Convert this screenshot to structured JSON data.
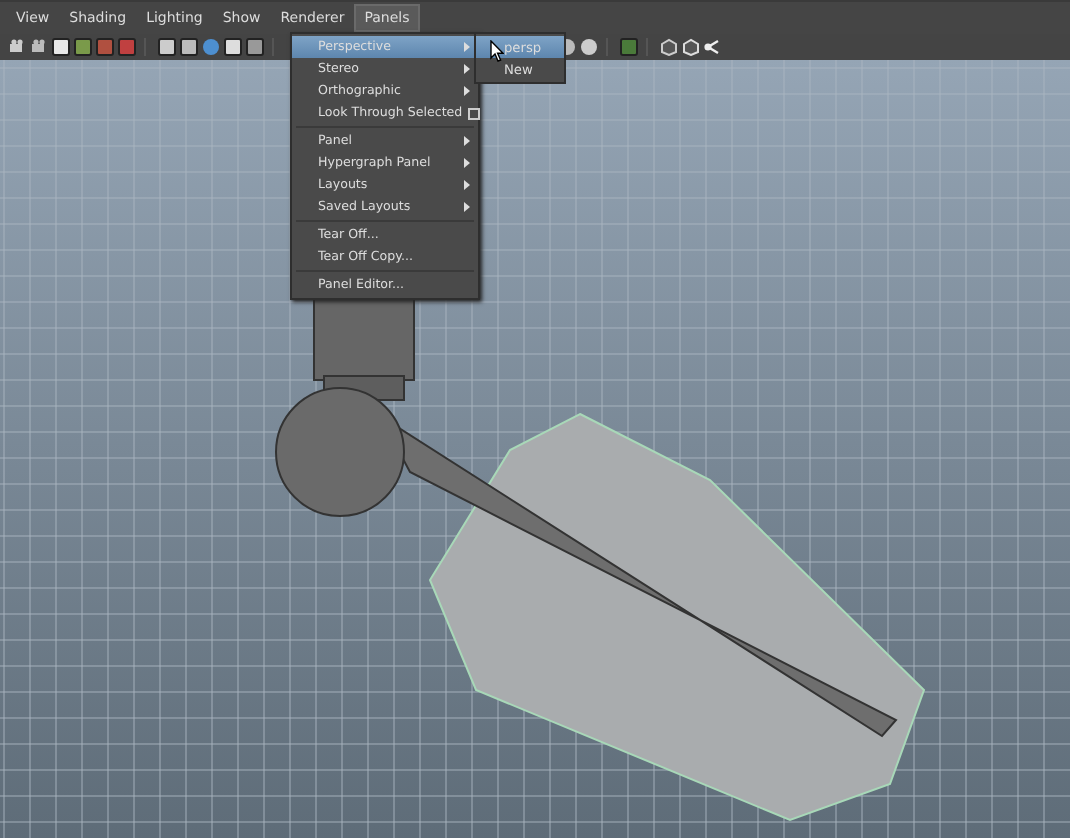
{
  "menubar": [
    {
      "label": "View",
      "selected": false
    },
    {
      "label": "Shading",
      "selected": false
    },
    {
      "label": "Lighting",
      "selected": false
    },
    {
      "label": "Show",
      "selected": false
    },
    {
      "label": "Renderer",
      "selected": false
    },
    {
      "label": "Panels",
      "selected": true
    }
  ],
  "menu": {
    "groups": [
      [
        {
          "label": "Perspective",
          "kind": "submenu",
          "selected": true
        },
        {
          "label": "Stereo",
          "kind": "submenu",
          "selected": false
        },
        {
          "label": "Orthographic",
          "kind": "submenu",
          "selected": false
        },
        {
          "label": "Look Through Selected",
          "kind": "checkbox",
          "checked": false,
          "selected": false
        }
      ],
      [
        {
          "label": "Panel",
          "kind": "submenu",
          "selected": false
        },
        {
          "label": "Hypergraph Panel",
          "kind": "submenu",
          "selected": false
        },
        {
          "label": "Layouts",
          "kind": "submenu",
          "selected": false
        },
        {
          "label": "Saved Layouts",
          "kind": "submenu",
          "selected": false
        }
      ],
      [
        {
          "label": "Tear Off...",
          "kind": "plain",
          "selected": false
        },
        {
          "label": "Tear Off Copy...",
          "kind": "plain",
          "selected": false
        }
      ],
      [
        {
          "label": "Panel Editor...",
          "kind": "plain",
          "selected": false
        }
      ]
    ]
  },
  "submenu": [
    {
      "label": "persp",
      "selected": true
    },
    {
      "label": "New",
      "selected": false
    }
  ]
}
